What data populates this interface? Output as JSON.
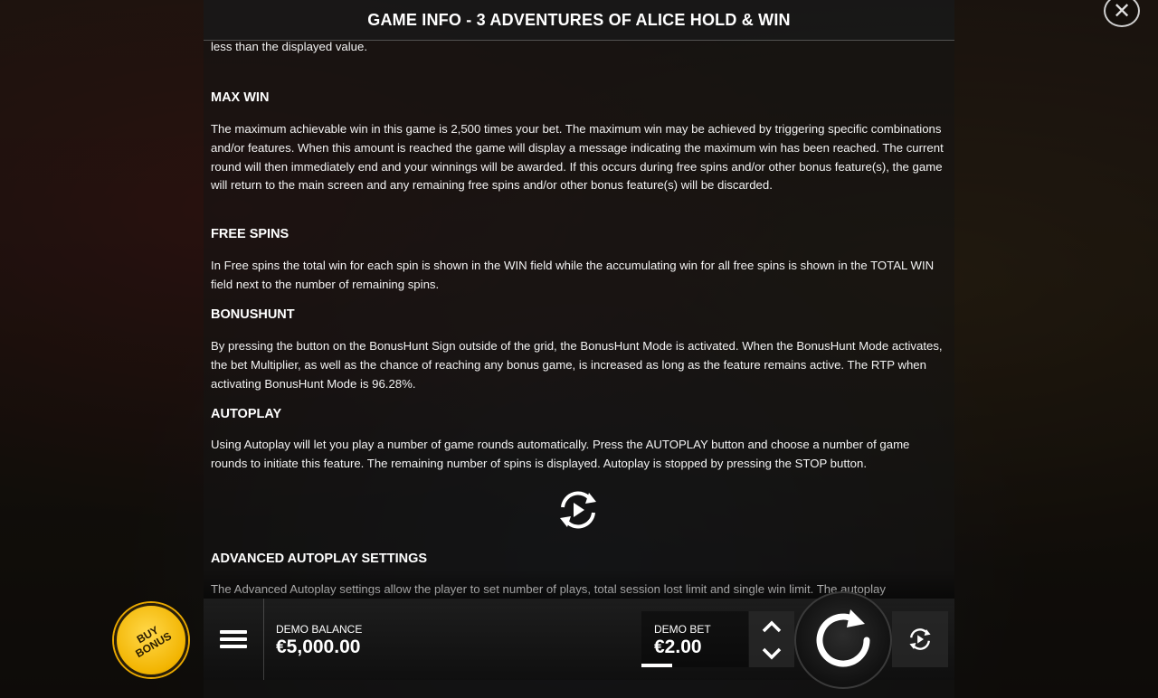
{
  "header": {
    "title": "GAME INFO - 3 ADVENTURES OF ALICE HOLD & WIN",
    "close_icon": "close-icon"
  },
  "content": {
    "intro_fragment": "less than the displayed value.",
    "sections": [
      {
        "heading": "MAX WIN",
        "text": "The maximum achievable win in this game is 2,500 times your bet. The maximum win may be achieved by triggering specific combinations and/or features. When this amount is reached the game will display a message indicating the maximum win has been reached. The current round will then immediately end and your winnings will be awarded. If this occurs during free spins and/or other bonus feature(s), the game will return to the main screen and any remaining free spins and/or other bonus feature(s) will be discarded."
      },
      {
        "heading": "FREE SPINS",
        "text": "In Free spins the total win for each spin is shown in the WIN field while the accumulating win for all free spins is shown in the TOTAL WIN field next to the number of remaining spins."
      },
      {
        "heading": "BONUSHUNT",
        "text": "By pressing the button on the BonusHunt Sign outside of the grid, the BonusHunt Mode is activated. When the BonusHunt Mode activates, the bet Multiplier, as well as the chance of reaching any bonus game, is increased as long as the feature remains active. The RTP when activating BonusHunt Mode is 96.28%."
      },
      {
        "heading": "AUTOPLAY",
        "text": "Using Autoplay will let you play a number of game rounds automatically. Press the AUTOPLAY button and choose a number of game rounds to initiate this feature. The remaining number of spins is displayed. Autoplay is stopped by pressing the STOP button."
      },
      {
        "heading": "ADVANCED AUTOPLAY SETTINGS",
        "text": "The Advanced Autoplay settings allow the player to set number of plays, total session lost limit and single win limit. The autoplay"
      }
    ],
    "autoplay_icon": "autoplay-icon"
  },
  "bottom_bar": {
    "buy_bonus_line1": "BUY",
    "buy_bonus_line2": "BONUS",
    "menu_icon": "menu-icon",
    "balance_label": "DEMO BALANCE",
    "balance_value": "€5,000.00",
    "bet_label": "DEMO BET",
    "bet_value": "€2.00",
    "spin_icon": "spin-icon",
    "autoplay_icon": "autoplay-icon"
  }
}
